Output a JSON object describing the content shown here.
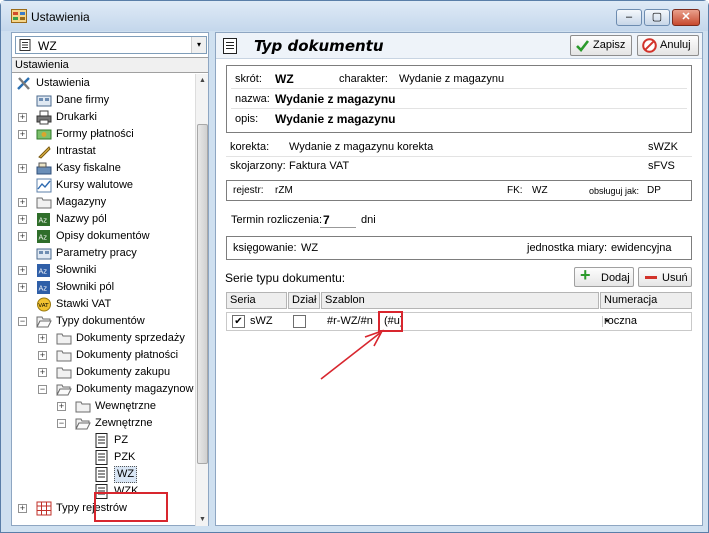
{
  "window": {
    "title": "Ustawienia",
    "close_glyph": "✕",
    "min_glyph": "–",
    "max_glyph": "▢"
  },
  "left": {
    "combo_value": "WZ",
    "combo_arrow": "▾",
    "header": "Ustawienia",
    "tree": [
      {
        "label": "Ustawienia",
        "level": 0,
        "expander": "",
        "icon": "tools-icon"
      },
      {
        "label": "Dane firmy",
        "level": 1,
        "expander": "",
        "icon": "company-icon"
      },
      {
        "label": "Drukarki",
        "level": 1,
        "expander": "+",
        "icon": "printer-icon"
      },
      {
        "label": "Formy płatności",
        "level": 1,
        "expander": "+",
        "icon": "money-icon"
      },
      {
        "label": "Intrastat",
        "level": 1,
        "expander": "",
        "icon": "pencil-icon"
      },
      {
        "label": "Kasy fiskalne",
        "level": 1,
        "expander": "+",
        "icon": "register-icon"
      },
      {
        "label": "Kursy walutowe",
        "level": 1,
        "expander": "",
        "icon": "chart-icon"
      },
      {
        "label": "Magazyny",
        "level": 1,
        "expander": "+",
        "icon": "folder-icon"
      },
      {
        "label": "Nazwy pól",
        "level": 1,
        "expander": "+",
        "icon": "az-green-icon"
      },
      {
        "label": "Opisy dokumentów",
        "level": 1,
        "expander": "+",
        "icon": "az-green-icon"
      },
      {
        "label": "Parametry pracy",
        "level": 1,
        "expander": "",
        "icon": "company-icon"
      },
      {
        "label": "Słowniki",
        "level": 1,
        "expander": "+",
        "icon": "az-blue-icon"
      },
      {
        "label": "Słowniki pól",
        "level": 1,
        "expander": "+",
        "icon": "az-blue-icon"
      },
      {
        "label": "Stawki VAT",
        "level": 1,
        "expander": "",
        "icon": "vat-icon"
      },
      {
        "label": "Typy dokumentów",
        "level": 1,
        "expander": "−",
        "icon": "folder-open-icon"
      },
      {
        "label": "Dokumenty sprzedaży",
        "level": 2,
        "expander": "+",
        "icon": "folder-icon"
      },
      {
        "label": "Dokumenty płatności",
        "level": 2,
        "expander": "+",
        "icon": "folder-icon"
      },
      {
        "label": "Dokumenty zakupu",
        "level": 2,
        "expander": "+",
        "icon": "folder-icon"
      },
      {
        "label": "Dokumenty magazynowe",
        "level": 2,
        "expander": "−",
        "icon": "folder-open-icon"
      },
      {
        "label": "Wewnętrzne",
        "level": 3,
        "expander": "+",
        "icon": "folder-icon"
      },
      {
        "label": "Zewnętrzne",
        "level": 3,
        "expander": "−",
        "icon": "folder-open-icon"
      },
      {
        "label": "PZ",
        "level": 4,
        "expander": "",
        "icon": "doc-icon"
      },
      {
        "label": "PZK",
        "level": 4,
        "expander": "",
        "icon": "doc-icon"
      },
      {
        "label": "WZ",
        "level": 4,
        "expander": "",
        "icon": "doc-icon",
        "selected": true
      },
      {
        "label": "WZK",
        "level": 4,
        "expander": "",
        "icon": "doc-icon"
      },
      {
        "label": "Typy rejestrów",
        "level": 1,
        "expander": "+",
        "icon": "grid-icon"
      }
    ]
  },
  "right": {
    "title": "Typ dokumentu",
    "save_label": "Zapisz",
    "cancel_label": "Anuluj",
    "skrot_label": "skrót:",
    "skrot_value": "WZ",
    "charakter_label": "charakter:",
    "charakter_value": "Wydanie z magazynu",
    "nazwa_label": "nazwa:",
    "nazwa_value": "Wydanie z magazynu",
    "opis_label": "opis:",
    "opis_value": "Wydanie z magazynu",
    "korekta_label": "korekta:",
    "korekta_value": "Wydanie z magazynu korekta",
    "korekta_code": "sWZK",
    "skojarzony_label": "skojarzony:",
    "skojarzony_value": "Faktura VAT",
    "skojarzony_code": "sFVS",
    "rejestr_label": "rejestr:",
    "rejestr_value": "rZM",
    "fk_label": "FK:",
    "fk_value": "WZ",
    "obsluguj_label": "obsługuj jak:",
    "obsluguj_value": "DP",
    "termin_label": "Termin rozliczenia:",
    "termin_value": "7",
    "termin_unit": "dni",
    "ksiegowanie_label": "księgowanie:",
    "ksiegowanie_value": "WZ",
    "jm_label": "jednostka miary:",
    "jm_value": "ewidencyjna",
    "serie_label": "Serie typu dokumentu:",
    "add_label": "Dodaj",
    "remove_label": "Usuń",
    "columns": [
      "Seria",
      "Dział",
      "Szablon",
      "Numeracja"
    ],
    "row": {
      "checked": "✔",
      "seria": "sWZ",
      "szablon_prefix": "#r-WZ/#n",
      "szablon_cut": "(#u)",
      "drop": "▾",
      "numeracja": "roczna"
    }
  },
  "colors": {
    "highlight": "#d8262e",
    "accent": "#2f6fb5"
  }
}
